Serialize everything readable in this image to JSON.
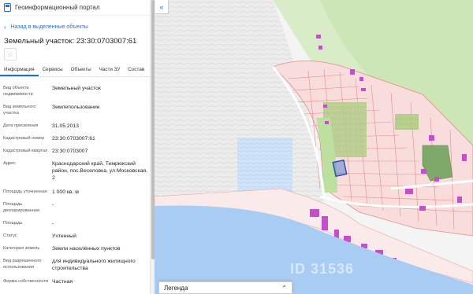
{
  "header": {
    "app_title": "Геоинформационный портал"
  },
  "nav": {
    "back_label": "Назад в выделенные объекты"
  },
  "object": {
    "title": "Земельный участок: 23:30:0703007:61"
  },
  "tabs": [
    "Информация",
    "Сервисы",
    "Объекты",
    "Части ЗУ",
    "Состав"
  ],
  "properties": [
    {
      "label": "Вид объекта недвижимости",
      "value": "Земельный участок"
    },
    {
      "label": "Вид земельного участка",
      "value": "Землепользование"
    },
    {
      "label": "Дата присвоения",
      "value": "31.05.2013"
    },
    {
      "label": "Кадастровый номер",
      "value": "23:30:0703007:61"
    },
    {
      "label": "Кадастровый квартал",
      "value": "23:30:0703007"
    },
    {
      "label": "Адрес",
      "value": "Краснодарский край, Темрюкский район, пос.Веселовка, ул.Московская, 2"
    },
    {
      "label": "Площадь уточненная",
      "value": "1 000 кв. м"
    },
    {
      "label": "Площадь декларированная",
      "value": "-"
    },
    {
      "label": "Площадь",
      "value": "-"
    },
    {
      "label": "Статус",
      "value": "Учтенный"
    },
    {
      "label": "Категория земель",
      "value": "Земли населённых пунктов"
    },
    {
      "label": "Вид разрешенного использования",
      "value": "для индивидуального жилищного строительства"
    },
    {
      "label": "Форма собственности",
      "value": "Частная"
    }
  ],
  "map": {
    "legend_label": "Легенда",
    "watermark": "ID 31536",
    "colors": {
      "sea": "#aacbf2",
      "land": "#eeeeee",
      "green": "#c6e3b0",
      "parcel": "#f7d5d5",
      "parcel_border": "#e08585",
      "building": "#c74fc9",
      "selected": "#2a6fd6"
    }
  }
}
